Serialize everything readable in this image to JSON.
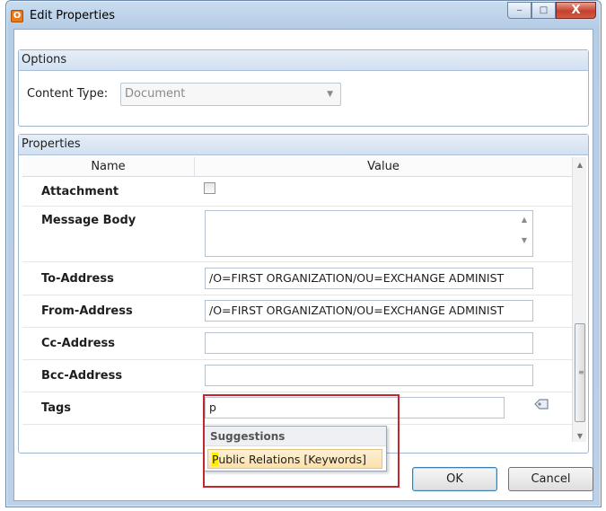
{
  "window": {
    "title": "Edit Properties",
    "app_icon_letter": "O",
    "controls": {
      "minimize": "‒",
      "maximize": "□",
      "close": "X"
    }
  },
  "options": {
    "header": "Options",
    "content_type_label": "Content Type:",
    "content_type_value": "Document"
  },
  "properties": {
    "header": "Properties",
    "columns": {
      "name": "Name",
      "value": "Value"
    },
    "rows": [
      {
        "name": "Attachment",
        "kind": "checkbox",
        "checked": false
      },
      {
        "name": "Message Body",
        "kind": "multiline",
        "value": ""
      },
      {
        "name": "To-Address",
        "kind": "text",
        "value": "/O=FIRST ORGANIZATION/OU=EXCHANGE ADMINIST"
      },
      {
        "name": "From-Address",
        "kind": "text",
        "value": "/O=FIRST ORGANIZATION/OU=EXCHANGE ADMINIST"
      },
      {
        "name": "Cc-Address",
        "kind": "text",
        "value": ""
      },
      {
        "name": "Bcc-Address",
        "kind": "text",
        "value": ""
      },
      {
        "name": "Tags",
        "kind": "text",
        "value": "p"
      }
    ]
  },
  "suggestions": {
    "header": "Suggestions",
    "items": [
      {
        "match": "P",
        "rest": "ublic Relations [Keywords]"
      }
    ]
  },
  "buttons": {
    "ok": "OK",
    "cancel": "Cancel"
  },
  "colors": {
    "highlight_border": "#c1272d",
    "match_highlight": "#ffee00"
  }
}
